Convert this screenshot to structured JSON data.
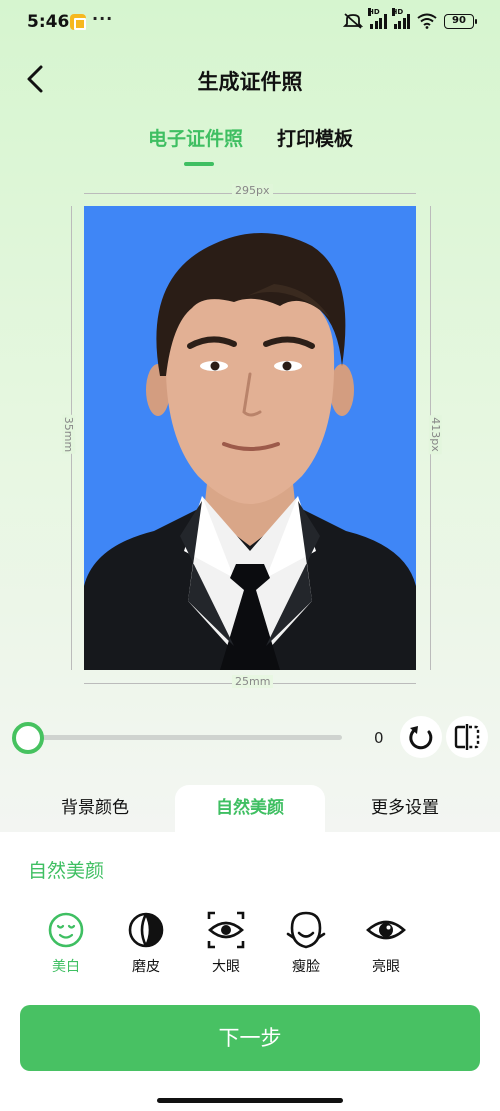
{
  "status_bar": {
    "time": "5:46",
    "dots": "···",
    "hd1": "HD",
    "hd2": "HD",
    "battery": "90"
  },
  "header": {
    "title": "生成证件照",
    "tabs": [
      {
        "label": "电子证件照",
        "active": true
      },
      {
        "label": "打印模板",
        "active": false
      }
    ]
  },
  "photo": {
    "width_label": "295px",
    "height_label": "413px",
    "width_mm": "25mm",
    "height_mm": "35mm",
    "background_color": "#3f86f6"
  },
  "slider": {
    "value": 0,
    "value_text": "0"
  },
  "panel": {
    "tabs": [
      {
        "label": "背景颜色"
      },
      {
        "label": "自然美颜",
        "active": true
      },
      {
        "label": "更多设置"
      }
    ],
    "heading": "自然美颜",
    "options": [
      {
        "label": "美白",
        "icon": "face-smile-icon",
        "active": true
      },
      {
        "label": "磨皮",
        "icon": "half-circle-icon"
      },
      {
        "label": "大眼",
        "icon": "eye-focus-icon"
      },
      {
        "label": "瘦脸",
        "icon": "face-slim-icon"
      },
      {
        "label": "亮眼",
        "icon": "eye-icon"
      }
    ]
  },
  "actions": {
    "next": "下一步"
  },
  "colors": {
    "accent": "#3fbf62",
    "button": "#48c163",
    "photo_bg": "#3f86f6"
  }
}
